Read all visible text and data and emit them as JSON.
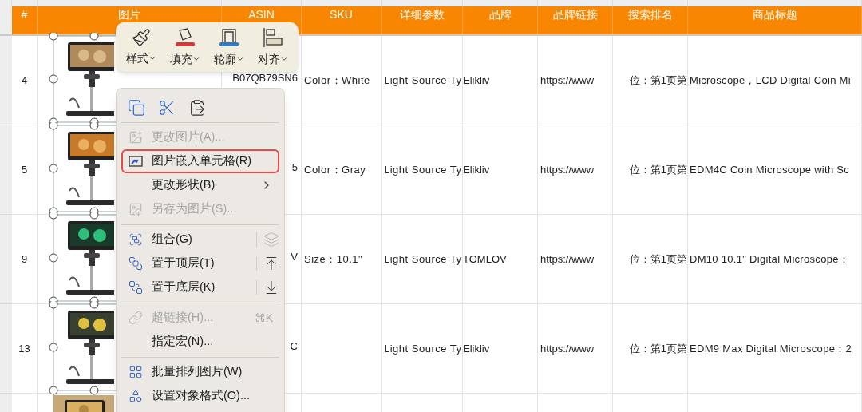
{
  "table": {
    "columns": [
      "#",
      "图片",
      "ASIN",
      "SKU",
      "详细参数",
      "品牌",
      "品牌链接",
      "搜索排名",
      "商品标题"
    ],
    "rows": [
      {
        "number": "4",
        "asin": "B07QB79SN6",
        "sku": "Color：White",
        "params": "Light Source Ty",
        "brand": "Elikliv",
        "link": "https://www",
        "rank": "位：第1页第",
        "title": "Microscope，LCD Digital Coin Mi"
      },
      {
        "number": "5",
        "asin": "5",
        "sku": "Color：Gray",
        "params": "Light Source Ty",
        "brand": "Elikliv",
        "link": "https://www",
        "rank": "位：第1页第",
        "title": "EDM4C Coin Microscope with Sc"
      },
      {
        "number": "9",
        "asin": "V",
        "sku": "Size：10.1\"",
        "params": "Light Source Ty",
        "brand": "TOMLOV",
        "link": "https://www",
        "rank": "位：第1页第",
        "title": "DM10 10.1\" Digital Microscope："
      },
      {
        "number": "13",
        "asin": "C",
        "params": "Light Source Ty",
        "brand": "Elikliv",
        "link": "https://www",
        "rank": "位：第1页第",
        "title": "EDM9 Max Digital Microscope：2"
      }
    ]
  },
  "toolbar": {
    "buttons": [
      {
        "label": "样式"
      },
      {
        "label": "填充"
      },
      {
        "label": "轮廓"
      },
      {
        "label": "对齐"
      }
    ]
  },
  "context_menu": {
    "sections": [
      {
        "items": [
          {
            "label": "更改图片(A)...",
            "disabled": true,
            "highlighted": false
          },
          {
            "label": "图片嵌入单元格(R)",
            "disabled": false,
            "highlighted": true
          },
          {
            "label": "更改形状(B)",
            "disabled": false,
            "highlighted": false,
            "submenu": true
          },
          {
            "label": "另存为图片(S)...",
            "disabled": true,
            "highlighted": false
          }
        ]
      },
      {
        "items": [
          {
            "label": "组合(G)",
            "disabled": false,
            "highlighted": false,
            "side_disabled": true
          },
          {
            "label": "置于顶层(T)",
            "disabled": false,
            "highlighted": false,
            "side_disabled": false
          },
          {
            "label": "置于底层(K)",
            "disabled": false,
            "highlighted": false,
            "side_disabled": false
          }
        ]
      },
      {
        "items": [
          {
            "label": "超链接(H)...",
            "disabled": true,
            "highlighted": false,
            "shortcut": "⌘K"
          },
          {
            "label": "指定宏(N)...",
            "disabled": false,
            "highlighted": false
          }
        ]
      },
      {
        "items": [
          {
            "label": "批量排列图片(W)",
            "disabled": false,
            "highlighted": false
          },
          {
            "label": "设置对象格式(O)...",
            "disabled": false,
            "highlighted": false
          }
        ]
      }
    ]
  }
}
